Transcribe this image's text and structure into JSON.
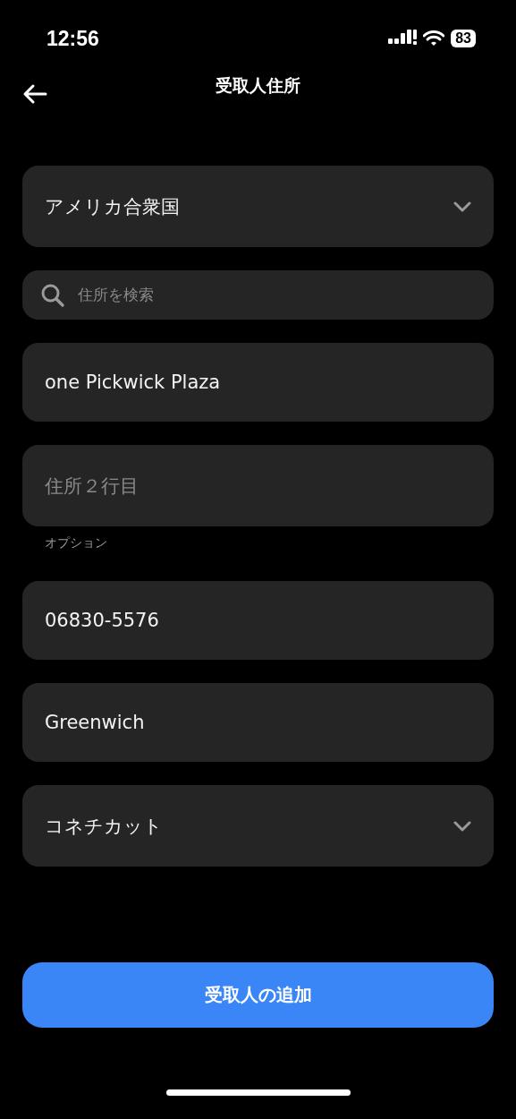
{
  "status_bar": {
    "time": "12:56",
    "battery": "83"
  },
  "header": {
    "title": "受取人住所"
  },
  "fields": [
    {
      "kind": "select",
      "value": "アメリカ合衆国"
    },
    {
      "kind": "search",
      "placeholder": "住所を検索"
    },
    {
      "kind": "text",
      "value": "one Pickwick Plaza"
    },
    {
      "kind": "text",
      "placeholder": "住所２行目",
      "hint": "オプション"
    },
    {
      "kind": "text",
      "value": "06830-5576"
    },
    {
      "kind": "text",
      "value": "Greenwich"
    },
    {
      "kind": "select",
      "value": "コネチカット"
    }
  ],
  "submit": {
    "label": "受取人の追加"
  }
}
